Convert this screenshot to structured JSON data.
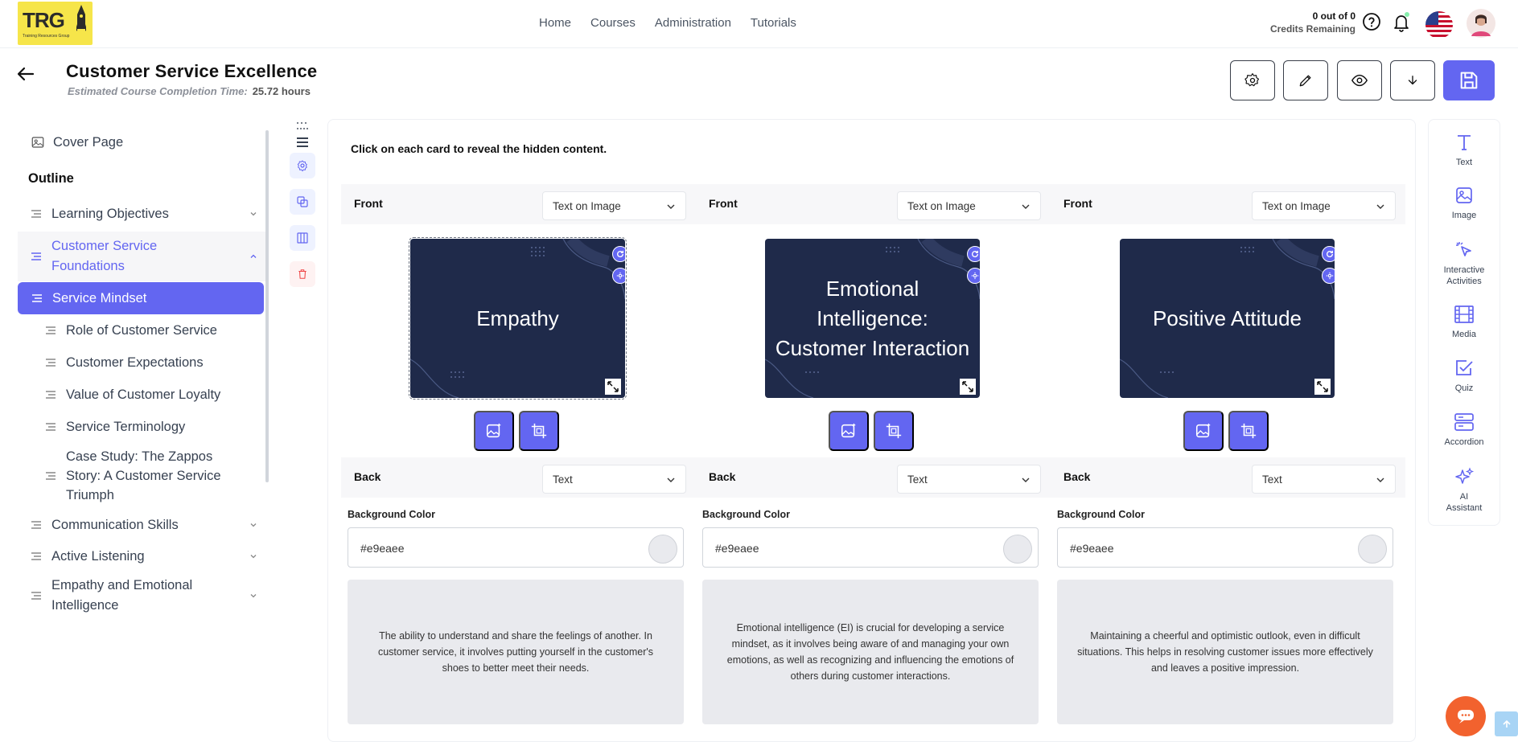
{
  "brand": {
    "logo_text": "TRG",
    "logo_subtitle": "Training Resources Group"
  },
  "nav": [
    "Home",
    "Courses",
    "Administration",
    "Tutorials"
  ],
  "credits": {
    "count": "0 out of 0",
    "label": "Credits Remaining"
  },
  "course": {
    "title": "Customer Service Excellence",
    "est_label": "Estimated Course Completion Time:",
    "est_value": "25.72 hours"
  },
  "toolbar": [
    "settings-icon",
    "edit-icon",
    "preview-icon",
    "download-icon",
    "save-icon"
  ],
  "sidebar": {
    "cover": "Cover Page",
    "outline": "Outline",
    "sections": [
      {
        "label": "Learning Objectives"
      },
      {
        "label": "Customer Service Foundations"
      },
      {
        "label": "Communication Skills"
      },
      {
        "label": "Active Listening"
      },
      {
        "label": "Empathy and Emotional Intelligence"
      }
    ],
    "subitems": [
      "Service Mindset",
      "Role of Customer Service",
      "Customer Expectations",
      "Value of Customer Loyalty",
      "Service Terminology",
      "Case Study: The Zappos Story: A Customer Service Triumph"
    ]
  },
  "content": {
    "instruction": "Click on each card to reveal the hidden content.",
    "front_label": "Front",
    "back_label": "Back",
    "bg_label": "Background Color",
    "cards": [
      {
        "front_mode": "Text on Image",
        "front_text": "Empathy",
        "back_mode": "Text",
        "bg_color": "#e9eaee",
        "back_text": "The ability to understand and share the feelings of another. In customer service, it involves putting yourself in the customer's shoes to better meet their needs."
      },
      {
        "front_mode": "Text on Image",
        "front_text": "Emotional Intelligence: Customer Interaction",
        "back_mode": "Text",
        "bg_color": "#e9eaee",
        "back_text": "Emotional intelligence (EI) is crucial for developing a service mindset, as it involves being aware of and managing your own emotions, as well as recognizing and influencing the emotions of others during customer interactions."
      },
      {
        "front_mode": "Text on Image",
        "front_text": "Positive Attitude",
        "back_mode": "Text",
        "bg_color": "#e9eaee",
        "back_text": "Maintaining a cheerful and optimistic outlook, even in difficult situations. This helps in resolving customer issues more effectively and leaves a positive impression."
      }
    ]
  },
  "right_panel": [
    {
      "label": "Text"
    },
    {
      "label": "Image"
    },
    {
      "label": "Interactive Activities"
    },
    {
      "label": "Media"
    },
    {
      "label": "Quiz"
    },
    {
      "label": "Accordion"
    },
    {
      "label": "AI Assistant"
    }
  ],
  "colors": {
    "accent": "#6366f1",
    "card_bg": "#1f2a4a",
    "chat": "#f2622e"
  }
}
